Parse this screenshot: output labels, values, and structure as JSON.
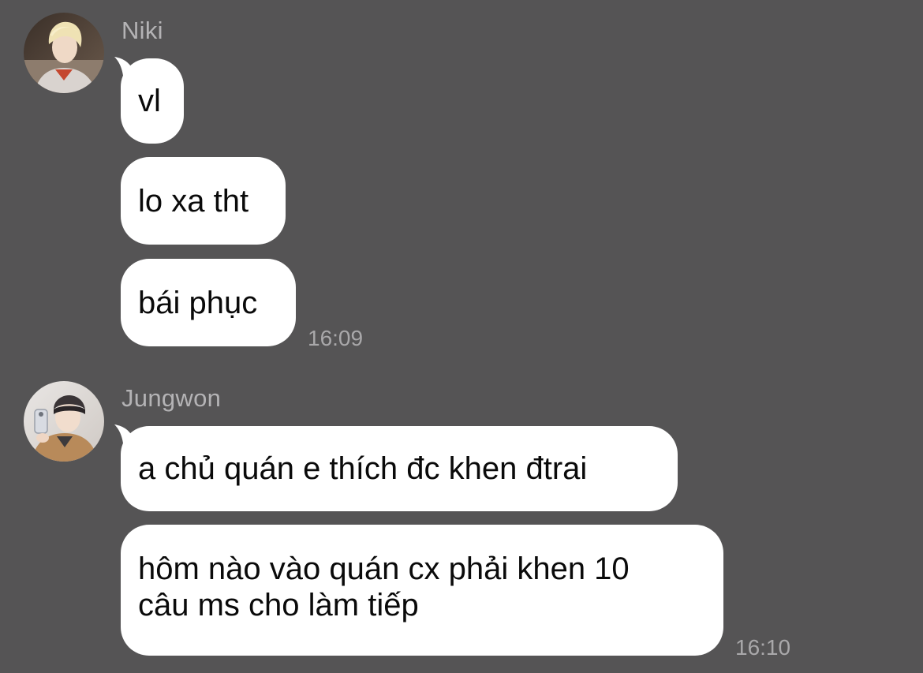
{
  "colors": {
    "background": "#555455",
    "bubble": "#ffffff",
    "message_text": "#0a0a0a",
    "sender_name": "#b4b3b5",
    "timestamp": "#a9a8aa"
  },
  "groups": [
    {
      "sender": "Niki",
      "avatar_icon": "user-avatar-niki",
      "messages": [
        "vl",
        "lo xa tht",
        "bái phục"
      ],
      "time": "16:09"
    },
    {
      "sender": "Jungwon",
      "avatar_icon": "user-avatar-jungwon",
      "messages": [
        "a chủ quán e thích đc khen đtrai",
        "hôm nào vào quán cx phải khen 10\ncâu ms cho làm tiếp"
      ],
      "time": "16:10"
    }
  ]
}
